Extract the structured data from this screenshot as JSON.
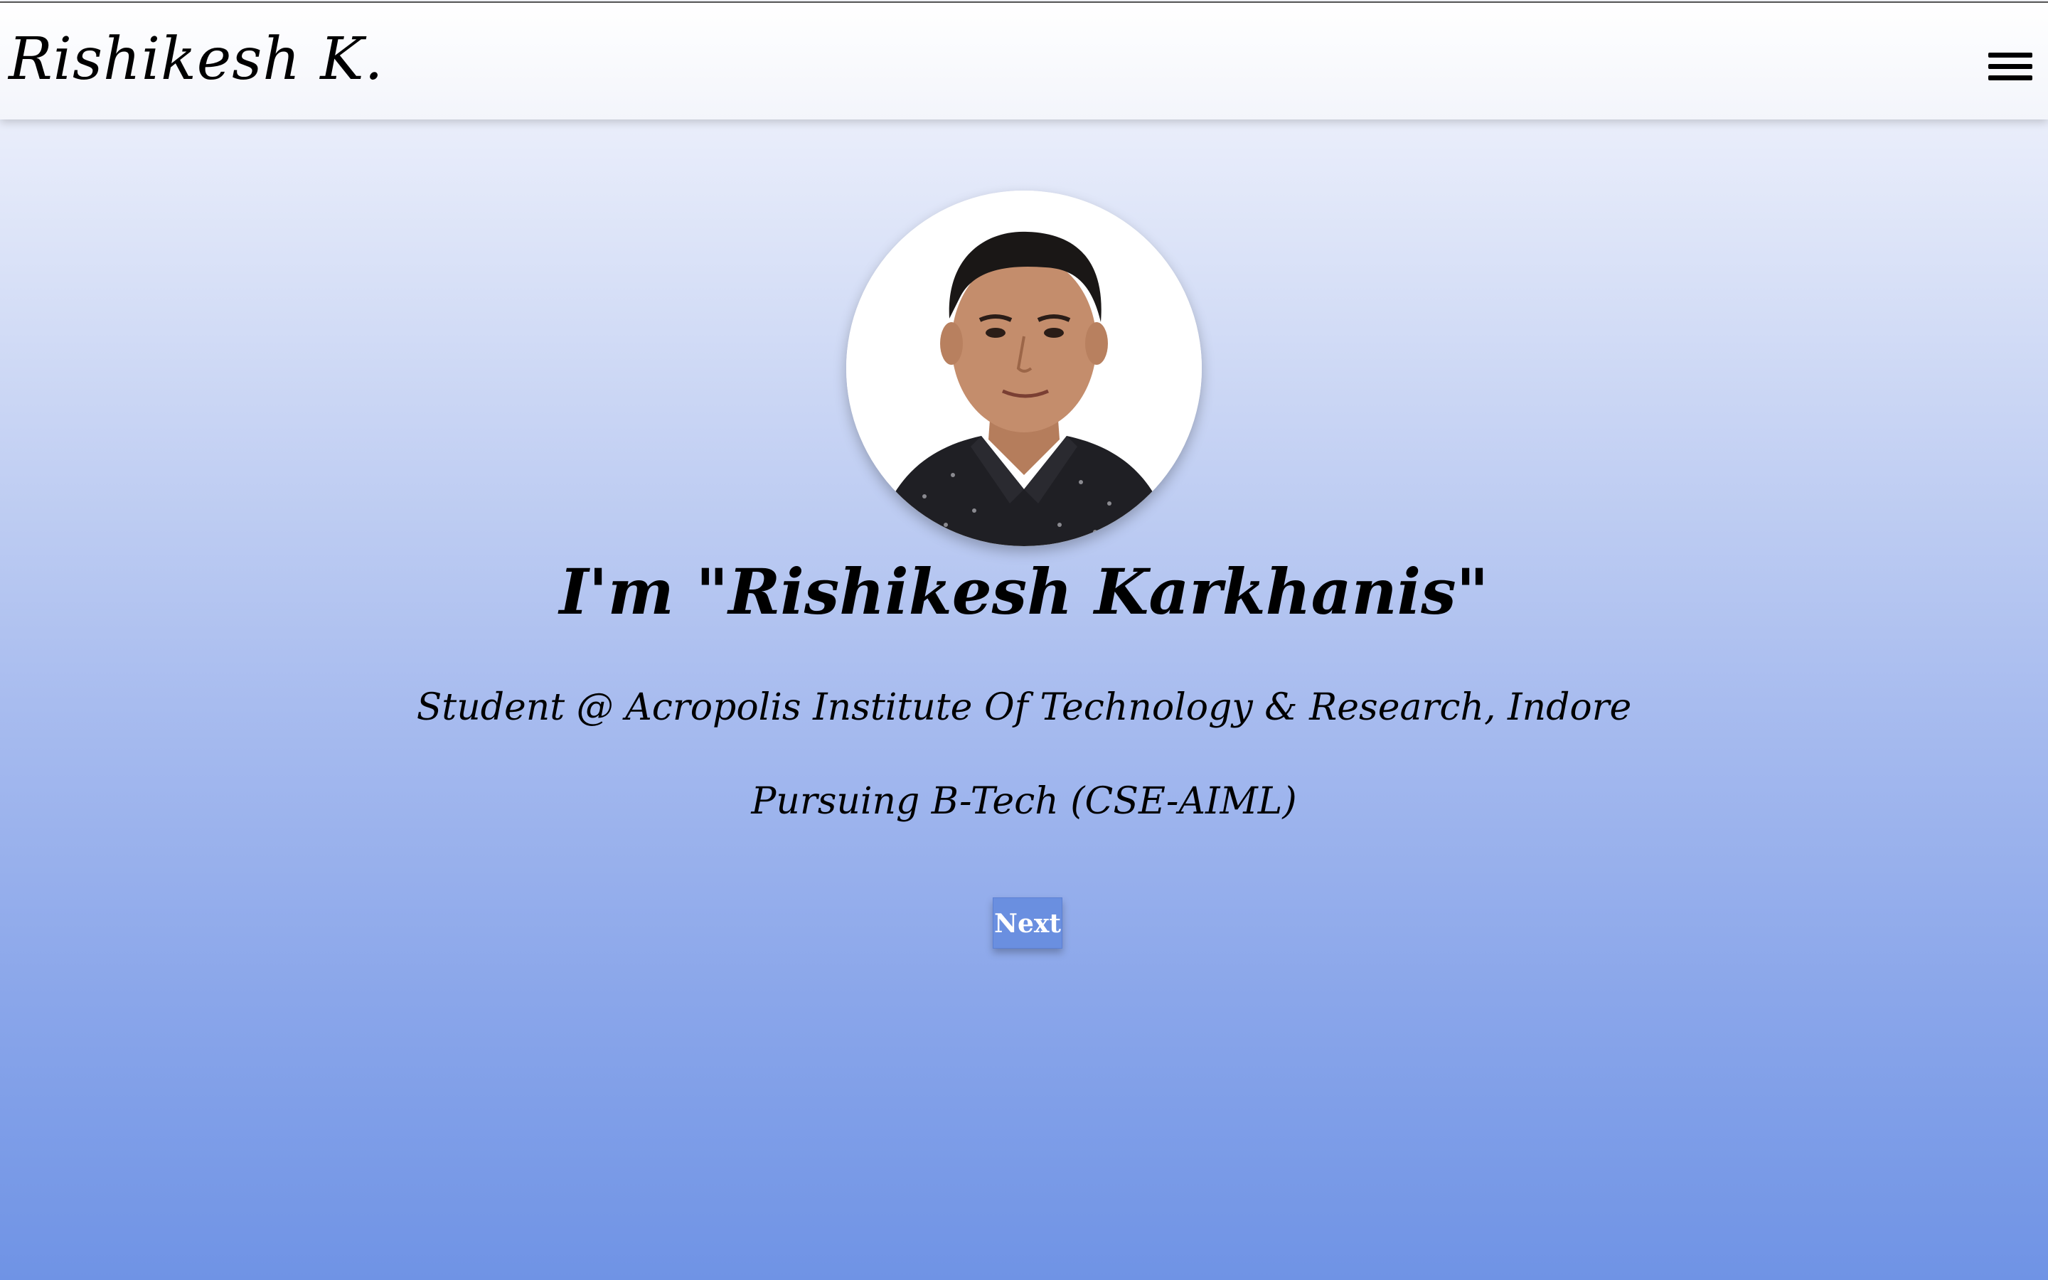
{
  "header": {
    "brand": "Rishikesh K.",
    "menu_icon": "hamburger-menu-icon"
  },
  "hero": {
    "avatar": "profile-photo",
    "headline": "I'm \"Rishikesh Karkhanis\"",
    "subline_1": "Student @ Acropolis Institute Of Technology & Research, Indore",
    "subline_2": "Pursuing B-Tech (CSE-AIML)",
    "next_label": "Next"
  },
  "colors": {
    "gradient_top": "#f7f8fc",
    "gradient_bottom": "#6f93e5",
    "button_bg": "#6a8fe0",
    "button_text": "#ffffff"
  }
}
